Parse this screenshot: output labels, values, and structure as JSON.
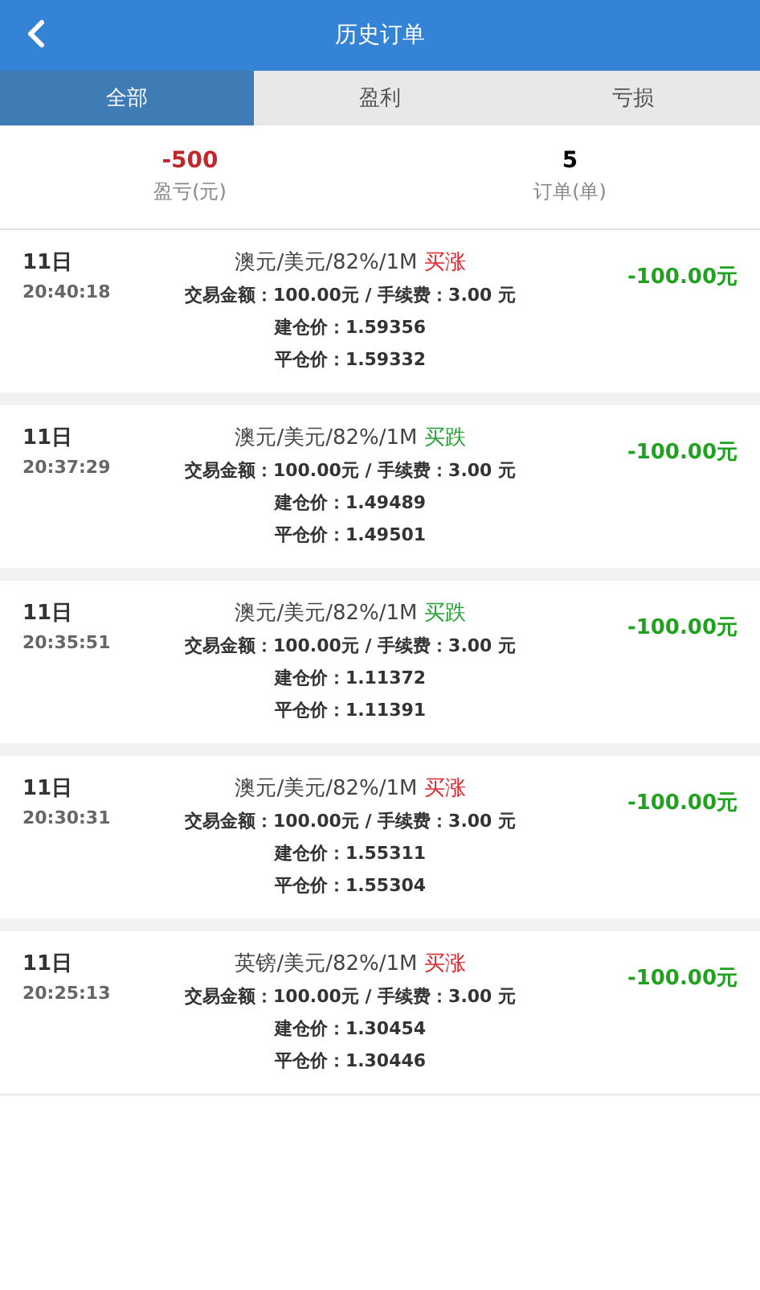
{
  "header": {
    "title": "历史订单"
  },
  "tabs": [
    {
      "label": "全部",
      "selected": true
    },
    {
      "label": "盈利",
      "selected": false
    },
    {
      "label": "亏损",
      "selected": false
    }
  ],
  "summary": [
    {
      "value": "-500",
      "label": "盈亏(元)",
      "kind": "loss"
    },
    {
      "value": "5",
      "label": "订单(单)",
      "kind": "count"
    }
  ],
  "orders": [
    {
      "day": "11日",
      "time": "20:40:18",
      "product": "澳元/美元/82%/1M",
      "direction": {
        "text": "买涨",
        "kind": "up"
      },
      "amount": "交易金额：100.00元 / 手续费：3.00 元",
      "open_price": "建仓价：1.59356",
      "close_price": "平仓价：1.59332",
      "pnl": "-100.00元"
    },
    {
      "day": "11日",
      "time": "20:37:29",
      "product": "澳元/美元/82%/1M",
      "direction": {
        "text": "买跌",
        "kind": "down"
      },
      "amount": "交易金额：100.00元 / 手续费：3.00 元",
      "open_price": "建仓价：1.49489",
      "close_price": "平仓价：1.49501",
      "pnl": "-100.00元"
    },
    {
      "day": "11日",
      "time": "20:35:51",
      "product": "澳元/美元/82%/1M",
      "direction": {
        "text": "买跌",
        "kind": "down"
      },
      "amount": "交易金额：100.00元 / 手续费：3.00 元",
      "open_price": "建仓价：1.11372",
      "close_price": "平仓价：1.11391",
      "pnl": "-100.00元"
    },
    {
      "day": "11日",
      "time": "20:30:31",
      "product": "澳元/美元/82%/1M",
      "direction": {
        "text": "买涨",
        "kind": "up"
      },
      "amount": "交易金额：100.00元 / 手续费：3.00 元",
      "open_price": "建仓价：1.55311",
      "close_price": "平仓价：1.55304",
      "pnl": "-100.00元"
    },
    {
      "day": "11日",
      "time": "20:25:13",
      "product": "英镑/美元/82%/1M",
      "direction": {
        "text": "买涨",
        "kind": "up"
      },
      "amount": "交易金额：100.00元 / 手续费：3.00 元",
      "open_price": "建仓价：1.30454",
      "close_price": "平仓价：1.30446",
      "pnl": "-100.00元"
    }
  ]
}
